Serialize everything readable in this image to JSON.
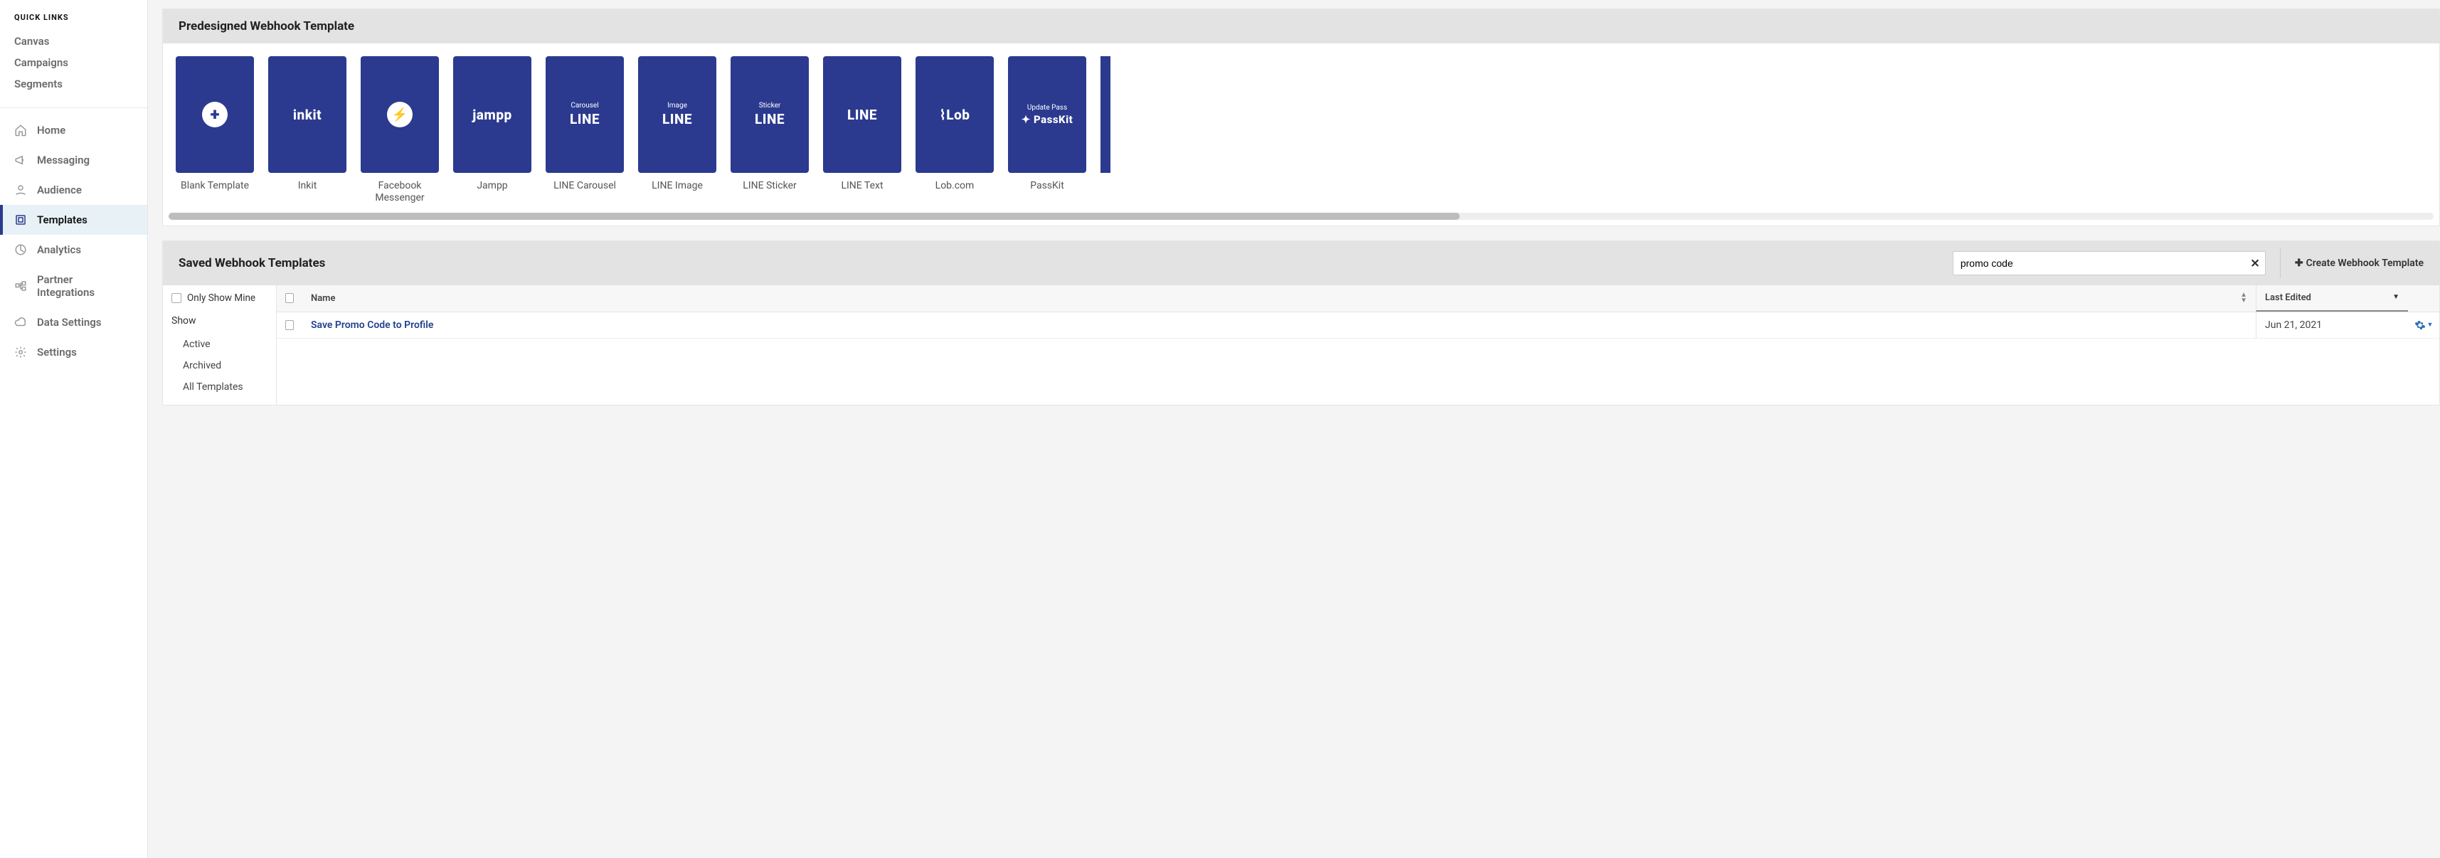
{
  "sidebar": {
    "quick_links_title": "QUICK LINKS",
    "quick_links": [
      "Canvas",
      "Campaigns",
      "Segments"
    ],
    "nav": [
      {
        "label": "Home",
        "icon": "home"
      },
      {
        "label": "Messaging",
        "icon": "messaging"
      },
      {
        "label": "Audience",
        "icon": "audience"
      },
      {
        "label": "Templates",
        "icon": "templates",
        "active": true
      },
      {
        "label": "Analytics",
        "icon": "analytics"
      },
      {
        "label": "Partner Integrations",
        "icon": "integrations"
      },
      {
        "label": "Data Settings",
        "icon": "data"
      },
      {
        "label": "Settings",
        "icon": "settings"
      }
    ]
  },
  "predesigned": {
    "title": "Predesigned Webhook Template",
    "cards": [
      {
        "label": "Blank Template",
        "brand": "plus"
      },
      {
        "label": "Inkit",
        "brand": "inkit"
      },
      {
        "label": "Facebook Messenger",
        "brand": "messenger"
      },
      {
        "label": "Jampp",
        "brand": "jampp"
      },
      {
        "label": "LINE Carousel",
        "brand": "LINE",
        "sup": "Carousel"
      },
      {
        "label": "LINE Image",
        "brand": "LINE",
        "sup": "Image"
      },
      {
        "label": "LINE Sticker",
        "brand": "LINE",
        "sup": "Sticker"
      },
      {
        "label": "LINE Text",
        "brand": "LINE"
      },
      {
        "label": "Lob.com",
        "brand": "Lob"
      },
      {
        "label": "PassKit",
        "brand": "PassKit",
        "sup": "Update Pass"
      }
    ]
  },
  "saved": {
    "title": "Saved Webhook Templates",
    "search_value": "promo code",
    "create_label": "Create Webhook Template",
    "only_mine_label": "Only Show Mine",
    "show_heading": "Show",
    "filters": [
      "Active",
      "Archived",
      "All Templates"
    ],
    "columns": {
      "name": "Name",
      "edited": "Last Edited"
    },
    "rows": [
      {
        "name": "Save Promo Code to Profile",
        "edited": "Jun 21, 2021"
      }
    ]
  }
}
